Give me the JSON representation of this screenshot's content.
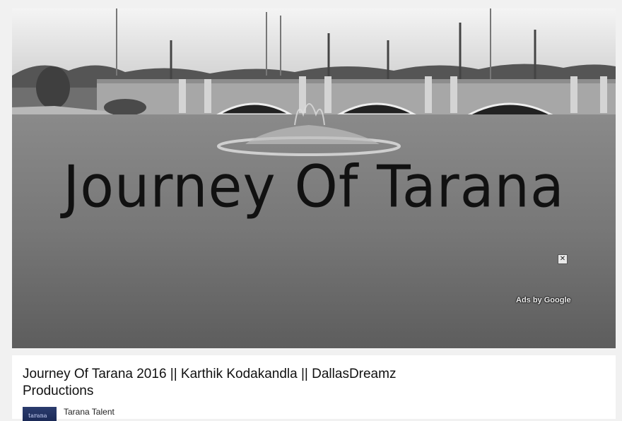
{
  "player": {
    "overlay_title": "Journey Of Tarana",
    "ad_close_glyph": "✕",
    "ads_label": "Ads by Google"
  },
  "video": {
    "title": "Journey Of Tarana 2016 || Karthik Kodakandla || DallasDreamz Productions",
    "channel_name": "Tarana Talent",
    "avatar_text": "tarana"
  }
}
